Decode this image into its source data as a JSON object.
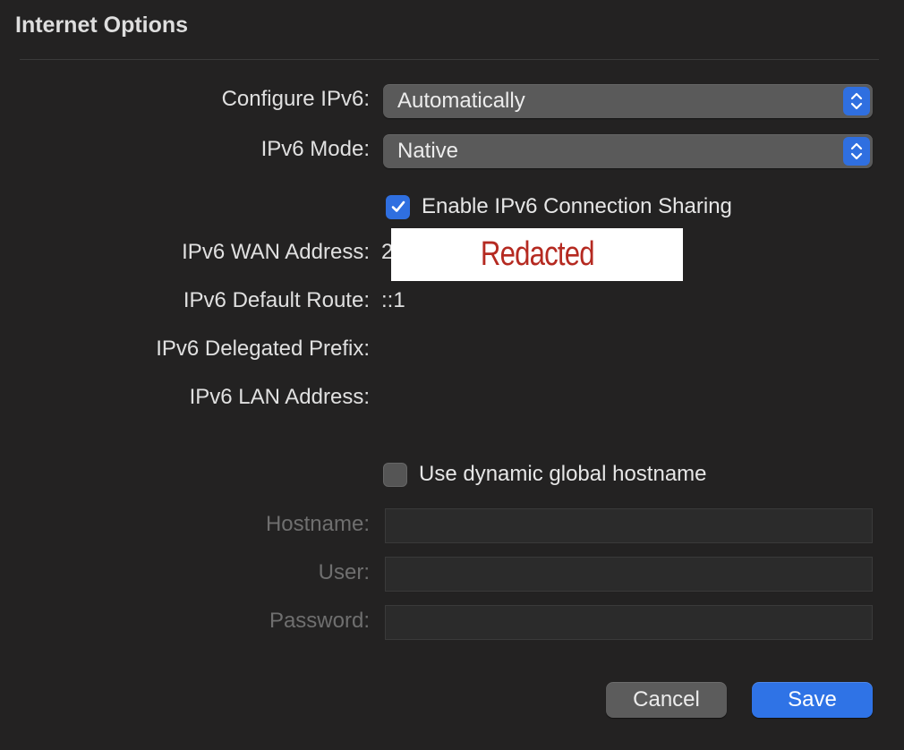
{
  "window": {
    "title": "Internet Options"
  },
  "form": {
    "configure_ipv6": {
      "label": "Configure IPv6:",
      "value": "Automatically"
    },
    "ipv6_mode": {
      "label": "IPv6 Mode:",
      "value": "Native"
    },
    "connection_sharing": {
      "label": "Enable IPv6 Connection Sharing",
      "checked": true
    },
    "wan_address": {
      "label": "IPv6 WAN Address:",
      "value_visible": "2",
      "redaction_text": "Redacted"
    },
    "default_route": {
      "label": "IPv6 Default Route:",
      "value": "::1"
    },
    "delegated_prefix": {
      "label": "IPv6 Delegated Prefix:",
      "value": ""
    },
    "lan_address": {
      "label": "IPv6 LAN Address:",
      "value": ""
    },
    "dynamic_hostname": {
      "label": "Use dynamic global hostname",
      "checked": false
    },
    "hostname": {
      "label": "Hostname:",
      "value": ""
    },
    "user": {
      "label": "User:",
      "value": ""
    },
    "password": {
      "label": "Password:",
      "value": ""
    }
  },
  "buttons": {
    "cancel": "Cancel",
    "save": "Save"
  },
  "colors": {
    "background": "#232222",
    "accent": "#2f73e6",
    "redaction_text": "#b52a21"
  },
  "icons": {
    "popup_stepper": "chevron-up-down-icon",
    "checkmark": "checkmark-icon"
  }
}
